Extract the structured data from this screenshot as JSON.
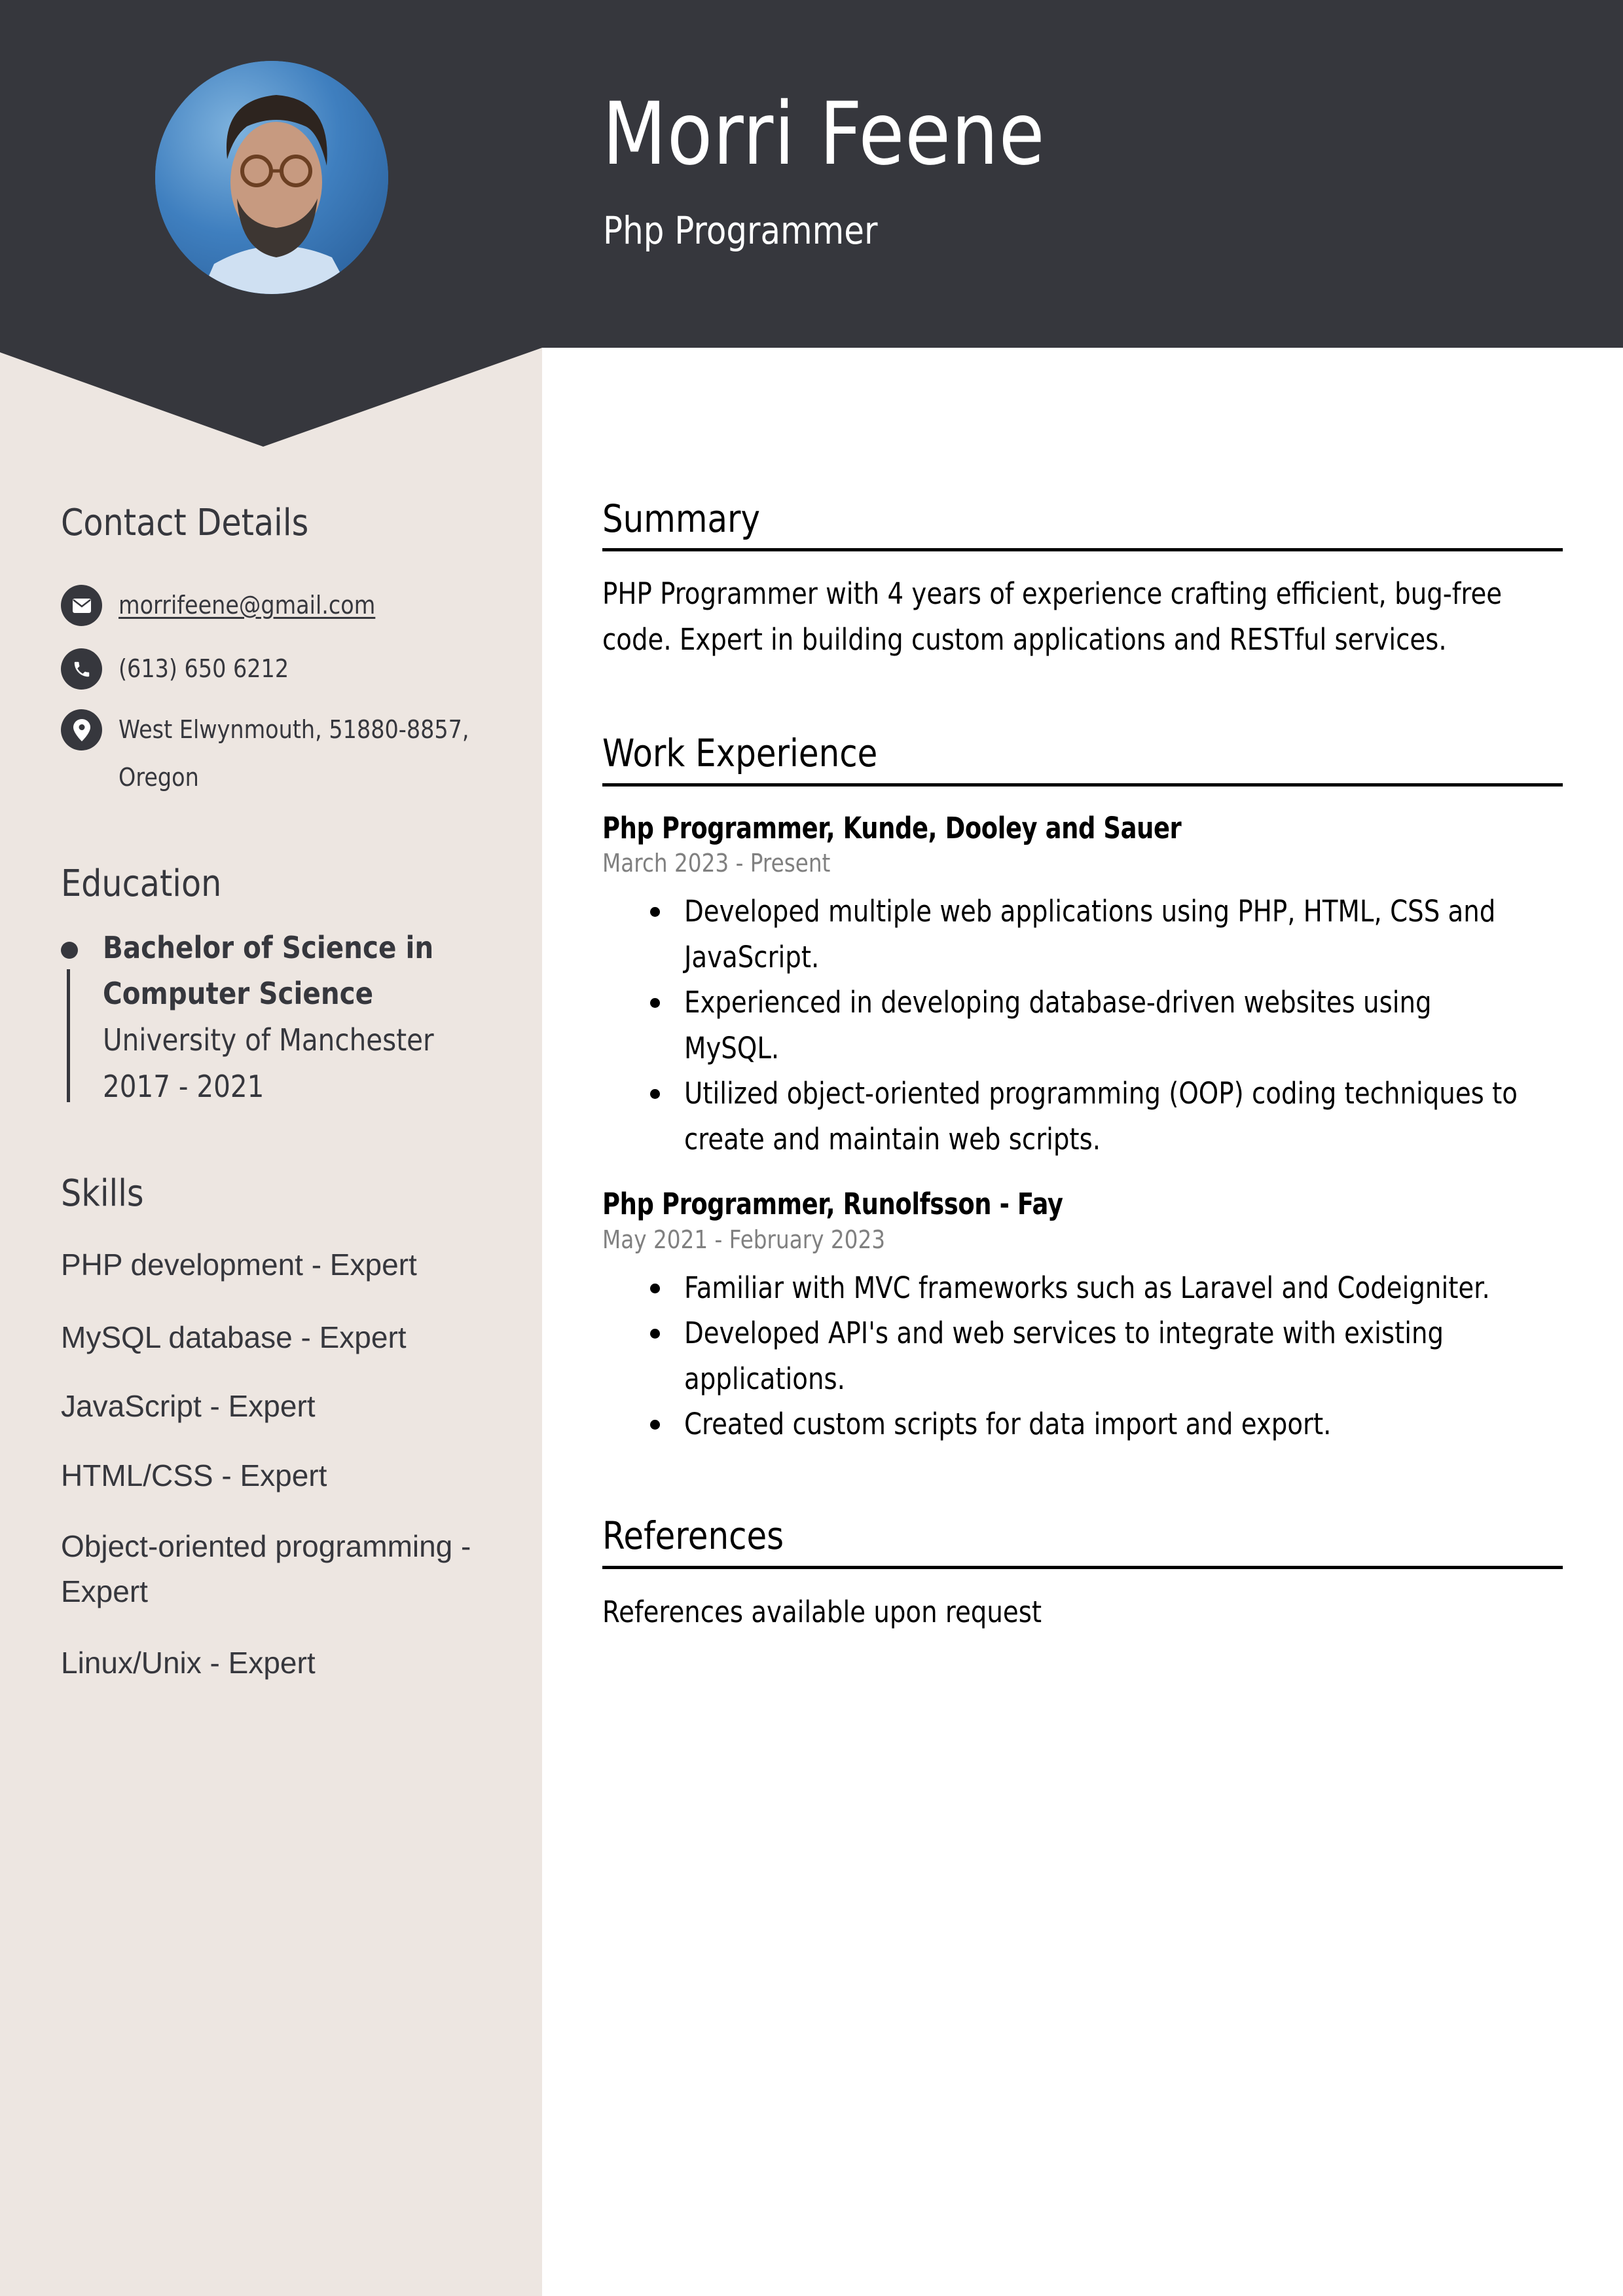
{
  "header": {
    "name": "Morri Feene",
    "title": "Php Programmer"
  },
  "colors": {
    "header_bg": "#36373d",
    "sidebar_bg": "#ede6e1",
    "text_dark": "#36373d",
    "date_gray": "#808080"
  },
  "sidebar": {
    "contact": {
      "heading": "Contact Details",
      "email": "morrifeene@gmail.com",
      "phone": "(613) 650 6212",
      "address_line1": "West Elwynmouth, 51880-8857,",
      "address_line2": "Oregon"
    },
    "education": {
      "heading": "Education",
      "degree_line1": "Bachelor of Science in",
      "degree_line2": "Computer Science",
      "school": "University of Manchester",
      "years": "2017 - 2021"
    },
    "skills": {
      "heading": "Skills",
      "items": [
        "PHP development - Expert",
        "MySQL database - Expert",
        "JavaScript - Expert",
        "HTML/CSS - Expert",
        "Object-oriented programming -",
        "Expert",
        "Linux/Unix - Expert"
      ]
    }
  },
  "main": {
    "summary": {
      "heading": "Summary",
      "lines": [
        "PHP Programmer with 4 years of experience crafting efficient, bug-free",
        "code. Expert in building custom applications and RESTful services."
      ]
    },
    "work": {
      "heading": "Work Experience",
      "jobs": [
        {
          "title": "Php Programmer, Kunde, Dooley and Sauer",
          "dates": "March 2023 - Present",
          "bullets": [
            [
              "Developed multiple web applications using PHP, HTML, CSS and",
              "JavaScript."
            ],
            [
              "Experienced in developing database-driven websites using",
              "MySQL."
            ],
            [
              "Utilized object-oriented programming (OOP) coding techniques to",
              "create and maintain web scripts."
            ]
          ]
        },
        {
          "title": "Php Programmer, Runolfsson - Fay",
          "dates": "May 2021 - February 2023",
          "bullets": [
            [
              "Familiar with MVC frameworks such as Laravel and Codeigniter."
            ],
            [
              "Developed API's and web services to integrate with existing",
              "applications."
            ],
            [
              "Created custom scripts for data import and export."
            ]
          ]
        }
      ]
    },
    "references": {
      "heading": "References",
      "text": "References available upon request"
    }
  }
}
